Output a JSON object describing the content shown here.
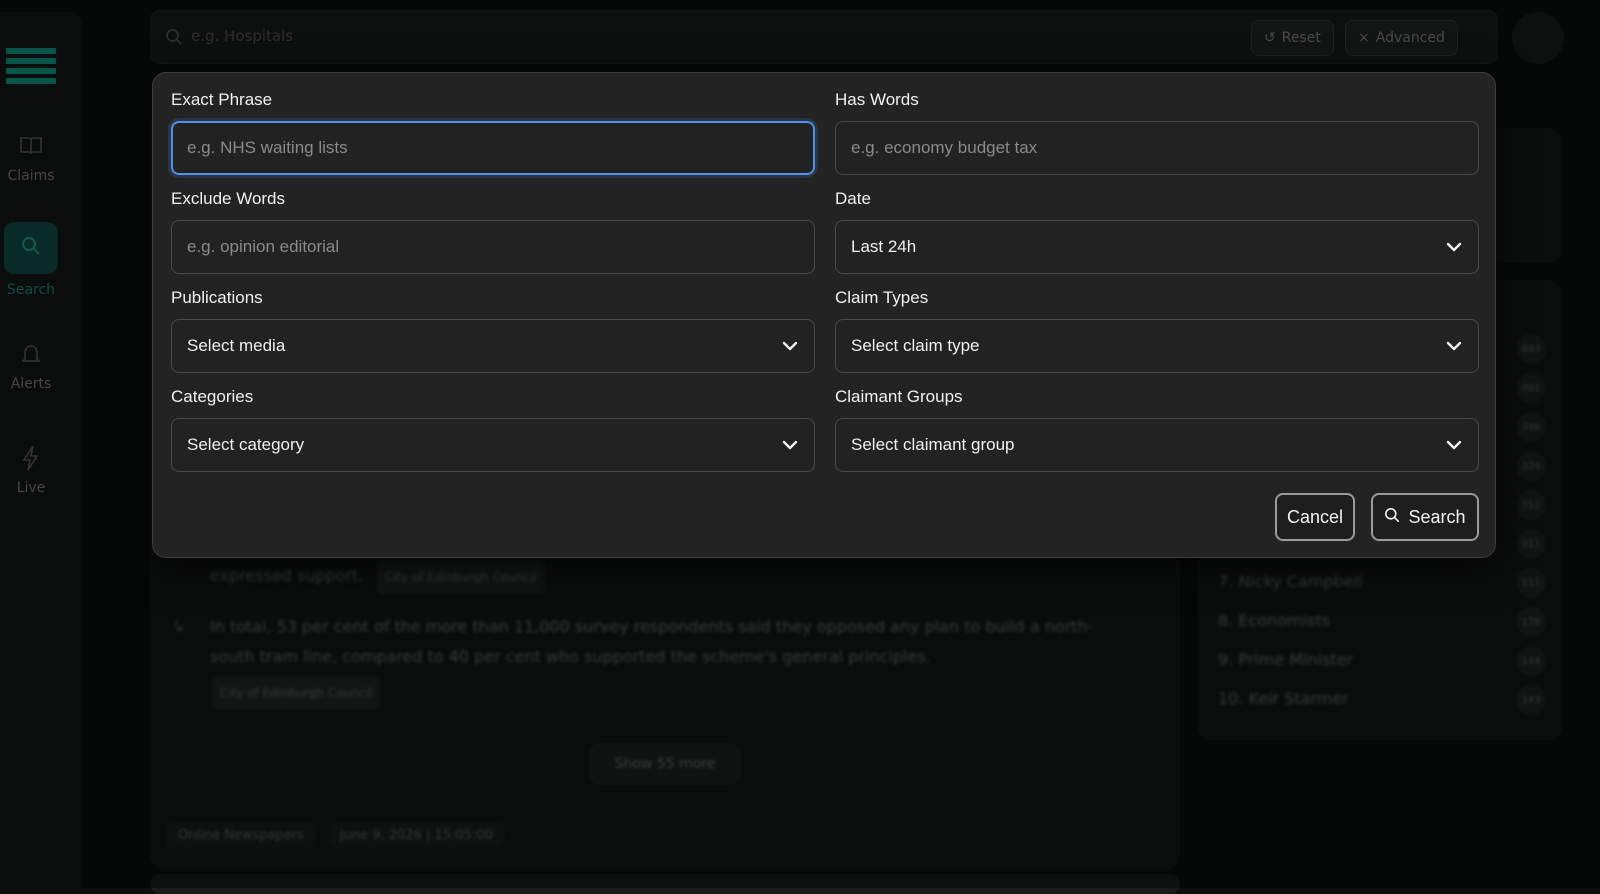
{
  "background": {
    "nav": [
      {
        "label": "Claims",
        "icon": "book-icon"
      },
      {
        "label": "Search",
        "icon": "search-icon"
      },
      {
        "label": "Alerts",
        "icon": "bell-icon"
      },
      {
        "label": "Live",
        "icon": "bolt-icon"
      }
    ],
    "search_placeholder": "e.g. Hospitals",
    "reset_label": "Reset",
    "advanced_label": "Advanced",
    "feed": {
      "line1": "expressed support.",
      "chip1": "City of Edinburgh Council",
      "line2a": "In total, 53 per cent of the more than 11,000 survey respondents said they opposed any plan to build a north-",
      "line2b": "south tram line, compared to 40 per cent who supported the scheme's general principles.",
      "chip2": "City of Edinburgh Council",
      "show_more": "Show 55 more",
      "source_chip": "Online Newspapers",
      "date_chip": "June 9, 2026  |  15:05:00"
    },
    "ranking": [
      {
        "label": "7. Nicky Campbell",
        "count": "111"
      },
      {
        "label": "8. Economists",
        "count": "178"
      },
      {
        "label": "9. Prime Minister",
        "count": "144"
      },
      {
        "label": "10. Keir Starmer",
        "count": "143"
      }
    ],
    "ranking_counts_top": [
      "893",
      "401",
      "346",
      "324",
      "312",
      "311"
    ]
  },
  "modal": {
    "exact_phrase": {
      "label": "Exact Phrase",
      "placeholder": "e.g. NHS waiting lists"
    },
    "has_words": {
      "label": "Has Words",
      "placeholder": "e.g. economy budget tax"
    },
    "exclude_words": {
      "label": "Exclude Words",
      "placeholder": "e.g. opinion editorial"
    },
    "date": {
      "label": "Date",
      "value": "Last 24h"
    },
    "publications": {
      "label": "Publications",
      "value": "Select media"
    },
    "claim_types": {
      "label": "Claim Types",
      "value": "Select claim type"
    },
    "categories": {
      "label": "Categories",
      "value": "Select category"
    },
    "claimant_groups": {
      "label": "Claimant Groups",
      "value": "Select claimant group"
    },
    "cancel_label": "Cancel",
    "search_label": "Search"
  },
  "colors": {
    "accent": "#4f8fe8",
    "brand": "#0f9b86"
  }
}
